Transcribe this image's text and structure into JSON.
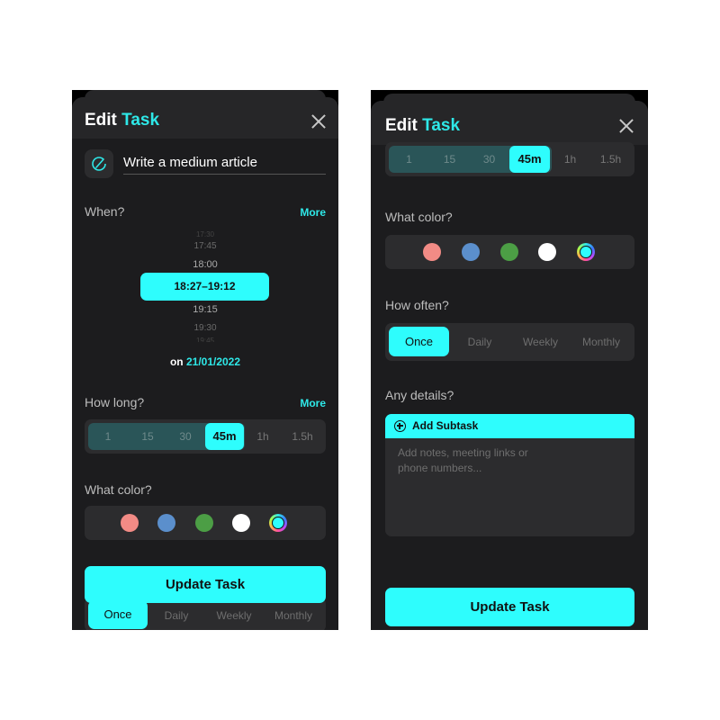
{
  "left_screen": {
    "header": {
      "title_plain": "Edit",
      "title_accent": "Task"
    },
    "task_name": "Write a medium article",
    "when": {
      "label": "When?",
      "more_label": "More",
      "times_above": [
        "17:30",
        "17:45",
        "18:00"
      ],
      "selected_range": "18:27–19:12",
      "times_below": [
        "19:15",
        "19:30",
        "19:45"
      ],
      "date_prefix": "on",
      "date": "21/01/2022"
    },
    "how_long": {
      "label": "How long?",
      "more_label": "More",
      "options": [
        "1",
        "15",
        "30",
        "45m",
        "1h",
        "1.5h"
      ],
      "selected": "45m"
    },
    "color": {
      "label": "What color?",
      "swatches": [
        "#f28b85",
        "#5b8fcc",
        "#4c9e45",
        "#ffffff",
        "rainbow-custom"
      ]
    },
    "frequency": {
      "options": [
        "Once",
        "Daily",
        "Weekly",
        "Monthly"
      ],
      "selected": "Once"
    },
    "primary_button": "Update Task"
  },
  "right_screen": {
    "header": {
      "title_plain": "Edit",
      "title_accent": "Task"
    },
    "how_long": {
      "options": [
        "1",
        "15",
        "30",
        "45m",
        "1h",
        "1.5h"
      ],
      "selected": "45m"
    },
    "color": {
      "label": "What color?",
      "swatches": [
        "#f28b85",
        "#5b8fcc",
        "#4c9e45",
        "#ffffff",
        "rainbow-custom"
      ]
    },
    "frequency": {
      "label": "How often?",
      "options": [
        "Once",
        "Daily",
        "Weekly",
        "Monthly"
      ],
      "selected": "Once"
    },
    "details": {
      "label": "Any details?",
      "add_subtask_label": "Add Subtask",
      "notes_placeholder": "Add notes, meeting links or phone numbers..."
    },
    "primary_button": "Update Task"
  },
  "colors": {
    "accent": "#2efdfd",
    "sheet": "#1c1c1e",
    "control": "#2c2c2e"
  }
}
